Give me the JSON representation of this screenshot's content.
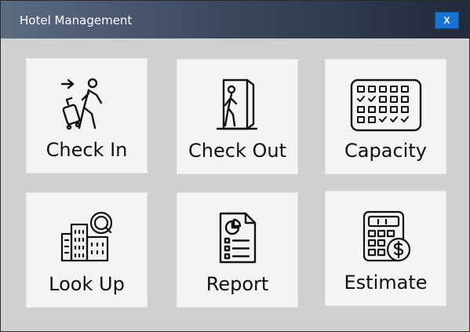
{
  "window": {
    "title": "Hotel Management",
    "close_label": "X"
  },
  "tiles": [
    {
      "label": "Check In",
      "icon": "traveler-luggage-icon"
    },
    {
      "label": "Check Out",
      "icon": "person-exit-door-icon"
    },
    {
      "label": "Capacity",
      "icon": "calendar-grid-icon"
    },
    {
      "label": "Look Up",
      "icon": "building-search-icon"
    },
    {
      "label": "Report",
      "icon": "report-document-icon"
    },
    {
      "label": "Estimate",
      "icon": "calculator-dollar-icon"
    }
  ],
  "colors": {
    "close_button": "#1a73d1",
    "tile_background": "#f2f4f7",
    "panel_background": "#d0d0d0"
  }
}
